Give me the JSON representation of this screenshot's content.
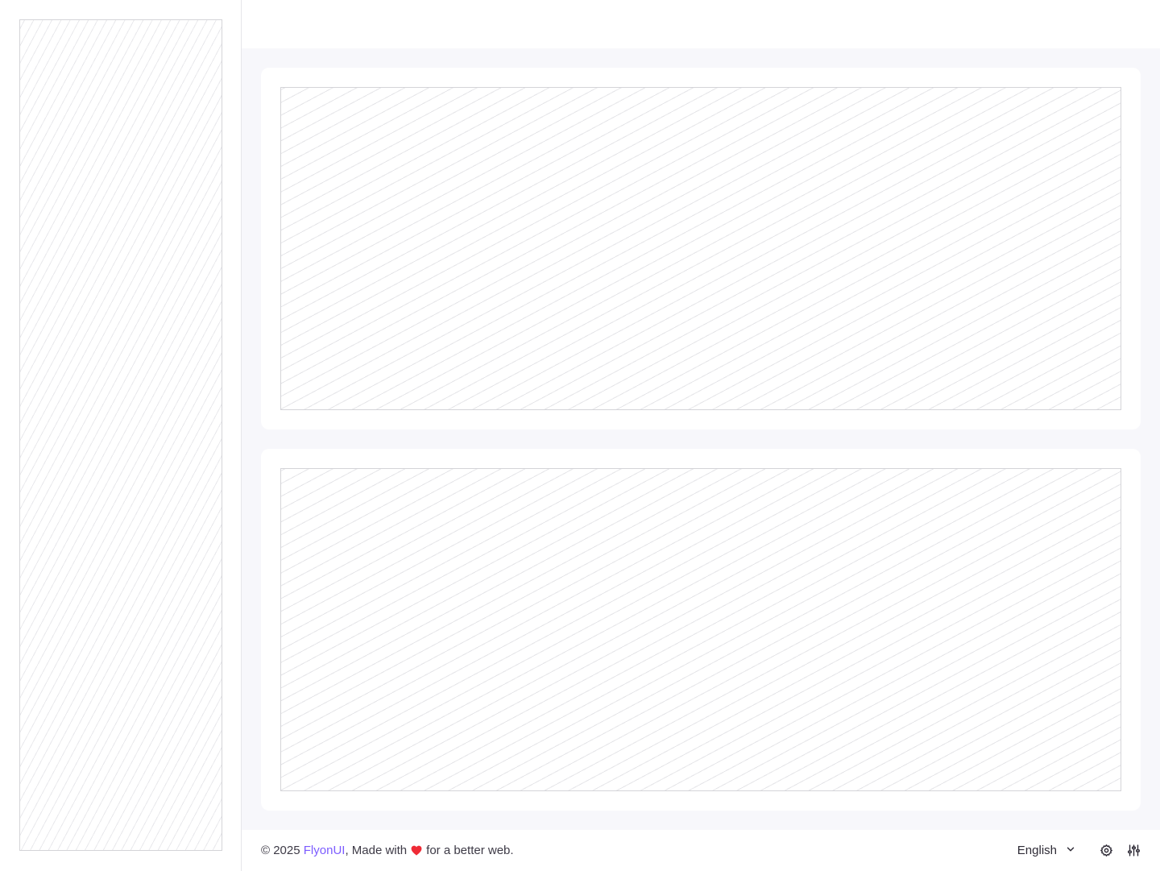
{
  "footer": {
    "copyright_prefix": "© 2025 ",
    "brand": "FlyonUI",
    "made_with": ", Made with",
    "suffix": "for a better web.",
    "language": "English",
    "heart_color": "#ef2b36",
    "brand_color": "#7c5cff"
  },
  "icons": {
    "heart": "heart-icon",
    "language_dropdown": "chevron-down-icon",
    "settings": "gear-icon",
    "customize": "sliders-icon"
  }
}
